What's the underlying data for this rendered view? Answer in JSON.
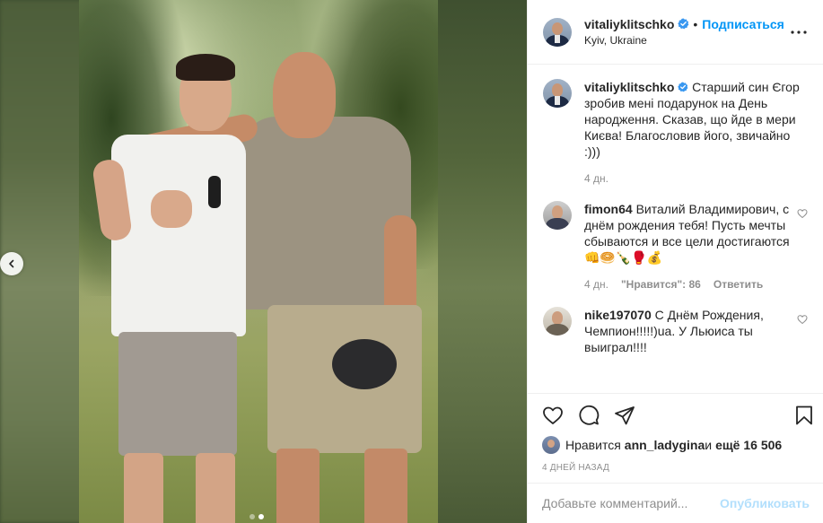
{
  "post": {
    "author": {
      "username": "vitaliyklitschko",
      "verified": true,
      "follow_label": "Подписаться",
      "separator": "•",
      "location": "Kyiv, Ukraine"
    },
    "caption": {
      "username": "vitaliyklitschko",
      "text": "Старший син Єгор зробив мені подарунок на День народження. Сказав, що йде в мери Києва! Благословив його, звичайно :)))",
      "age": "4 дн."
    },
    "comments": [
      {
        "username": "fimon64",
        "text": "Виталий Владимирович, с днём рождения тебя! Пусть мечты сбываются и все цели достигаются 👊🥯🍾🥊💰",
        "age": "4 дн.",
        "likes_label": "\"Нравится\": 86",
        "reply_label": "Ответить"
      },
      {
        "username": "nike197070",
        "text": "С Днём Рождения, Чемпион!!!!!)ua. У Льюиса ты выиграл!!!!"
      }
    ],
    "likes": {
      "prefix": "Нравится",
      "user": "ann_ladygina",
      "middle": "и",
      "rest": "ещё 16 506"
    },
    "date": "4 ДНЕЙ НАЗАД",
    "add_comment": {
      "placeholder": "Добавьте комментарий...",
      "publish_label": "Опубликовать"
    },
    "carousel": {
      "total": 2,
      "active": 2
    }
  },
  "icons": {
    "like": "heart-icon",
    "comment": "comment-icon",
    "share": "paper-plane-icon",
    "save": "bookmark-icon",
    "more": "more-horizontal-icon",
    "prev": "chevron-left-icon",
    "verified": "verified-badge-icon"
  },
  "colors": {
    "accent": "#0095f6",
    "verified": "#3897f0",
    "publish_disabled": "#b2dffc",
    "muted": "#8e8e8e"
  }
}
